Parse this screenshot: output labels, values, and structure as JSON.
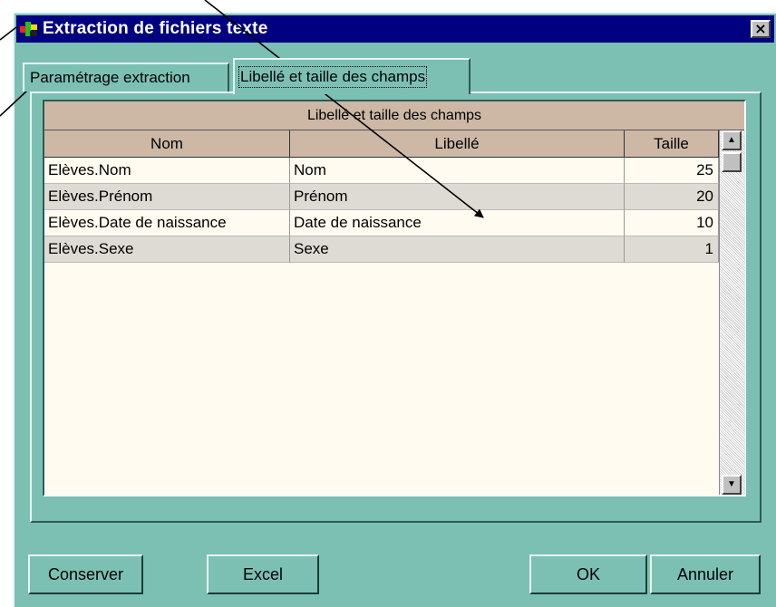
{
  "window": {
    "title": "Extraction de fichiers texte",
    "close_glyph": "×"
  },
  "tabs": [
    {
      "label": "Paramétrage extraction",
      "active": false
    },
    {
      "label": "Libellé et taille des champs",
      "active": true
    }
  ],
  "grid": {
    "caption": "Libellé et taille des champs",
    "columns": [
      "Nom",
      "Libellé",
      "Taille"
    ],
    "rows": [
      {
        "nom": "Elèves.Nom",
        "libelle": "Nom",
        "taille": "25"
      },
      {
        "nom": "Elèves.Prénom",
        "libelle": "Prénom",
        "taille": "20"
      },
      {
        "nom": "Elèves.Date de naissance",
        "libelle": "Date de naissance",
        "taille": "10"
      },
      {
        "nom": "Elèves.Sexe",
        "libelle": "Sexe",
        "taille": "1"
      }
    ]
  },
  "buttons": {
    "conserver": "Conserver",
    "excel": "Excel",
    "ok": "OK",
    "annuler": "Annuler"
  },
  "icons": {
    "app": "app-icon",
    "close": "close-icon",
    "scroll_up": "scroll-up-icon",
    "scroll_down": "scroll-down-icon"
  },
  "colors": {
    "dialog_bg": "#7cc0b4",
    "titlebar": "#000080",
    "header_bg": "#cdb8a6",
    "grid_bg": "#fffbf0",
    "alt_row": "#dedbd4"
  }
}
